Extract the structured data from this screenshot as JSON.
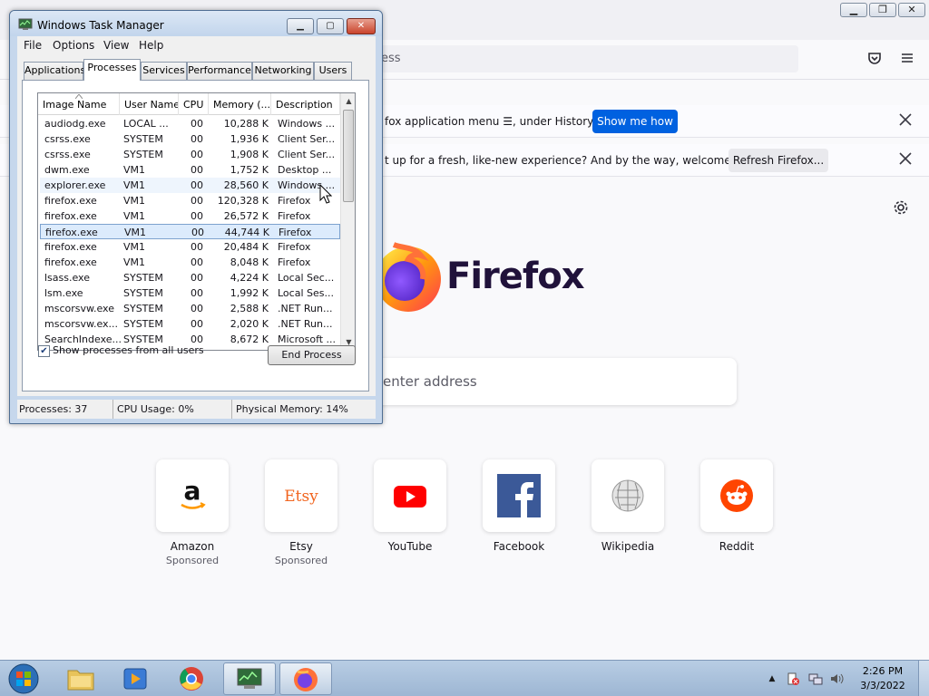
{
  "firefox": {
    "window_controls": {
      "minimize": "▁",
      "restore": "❐",
      "close": "✕"
    },
    "url_fragment": "ess",
    "notif1": {
      "text": "fox application menu ☰, under History.",
      "button": "Show me how"
    },
    "notif2": {
      "text": "t up for a fresh, like-new experience? And by the way, welcome back!",
      "button": "Refresh Firefox..."
    },
    "brand": "Firefox",
    "search_placeholder": "enter address",
    "shortcuts": [
      {
        "label": "Amazon",
        "sub": "Sponsored",
        "icon": "amazon-icon"
      },
      {
        "label": "Etsy",
        "sub": "Sponsored",
        "icon": "etsy-icon",
        "logo_text": "Etsy"
      },
      {
        "label": "YouTube",
        "sub": "",
        "icon": "youtube-icon"
      },
      {
        "label": "Facebook",
        "sub": "",
        "icon": "facebook-icon"
      },
      {
        "label": "Wikipedia",
        "sub": "",
        "icon": "wikipedia-icon"
      },
      {
        "label": "Reddit",
        "sub": "",
        "icon": "reddit-icon"
      }
    ]
  },
  "taskmanager": {
    "title": "Windows Task Manager",
    "controls": {
      "minimize": "▁",
      "maximize": "▢",
      "close": "✕"
    },
    "menu": [
      "File",
      "Options",
      "View",
      "Help"
    ],
    "tabs": [
      "Applications",
      "Processes",
      "Services",
      "Performance",
      "Networking",
      "Users"
    ],
    "active_tab": "Processes",
    "columns": [
      "Image Name",
      "User Name",
      "CPU",
      "Memory (...",
      "Description"
    ],
    "rows": [
      [
        "audiodg.exe",
        "LOCAL ...",
        "00",
        "10,288 K",
        "Windows ..."
      ],
      [
        "csrss.exe",
        "SYSTEM",
        "00",
        "1,936 K",
        "Client Ser..."
      ],
      [
        "csrss.exe",
        "SYSTEM",
        "00",
        "1,908 K",
        "Client Ser..."
      ],
      [
        "dwm.exe",
        "VM1",
        "00",
        "1,752 K",
        "Desktop ..."
      ],
      [
        "explorer.exe",
        "VM1",
        "00",
        "28,560 K",
        "Windows ..."
      ],
      [
        "firefox.exe",
        "VM1",
        "00",
        "120,328 K",
        "Firefox"
      ],
      [
        "firefox.exe",
        "VM1",
        "00",
        "26,572 K",
        "Firefox"
      ],
      [
        "firefox.exe",
        "VM1",
        "00",
        "44,744 K",
        "Firefox"
      ],
      [
        "firefox.exe",
        "VM1",
        "00",
        "20,484 K",
        "Firefox"
      ],
      [
        "firefox.exe",
        "VM1",
        "00",
        "8,048 K",
        "Firefox"
      ],
      [
        "lsass.exe",
        "SYSTEM",
        "00",
        "4,224 K",
        "Local Sec..."
      ],
      [
        "lsm.exe",
        "SYSTEM",
        "00",
        "1,992 K",
        "Local Ses..."
      ],
      [
        "mscorsvw.exe",
        "SYSTEM",
        "00",
        "2,588 K",
        ".NET Run..."
      ],
      [
        "mscorsvw.ex...",
        "SYSTEM",
        "00",
        "2,020 K",
        ".NET Run..."
      ],
      [
        "SearchIndexe...",
        "SYSTEM",
        "00",
        "8,672 K",
        "Microsoft ..."
      ]
    ],
    "selected_row": 7,
    "hover_row": 4,
    "show_all_label": "Show processes from all users",
    "show_all_checked": "✔",
    "end_process": "End Process",
    "status": {
      "processes": "Processes: 37",
      "cpu": "CPU Usage: 0%",
      "memory": "Physical Memory: 14%"
    }
  },
  "taskbar": {
    "time": "2:26 PM",
    "date": "3/3/2022",
    "tray_arrow": "▲",
    "apps": [
      "start-orb",
      "explorer",
      "media-player",
      "chrome",
      "task-manager",
      "firefox"
    ]
  }
}
